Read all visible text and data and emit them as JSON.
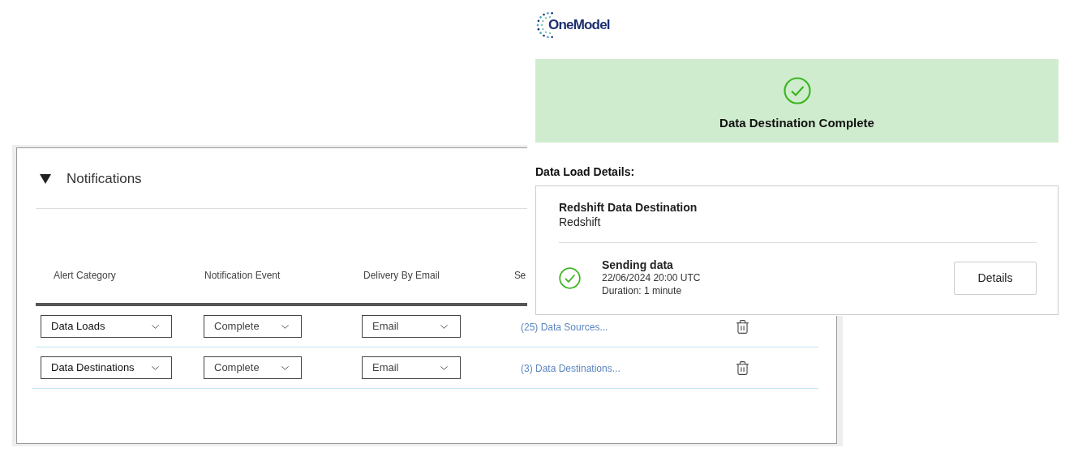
{
  "notifications_panel": {
    "title": "Notifications",
    "expanded": true,
    "columns": [
      "Alert Category",
      "Notification Event",
      "Delivery By Email",
      "Se"
    ],
    "rows": [
      {
        "alert_category": "Data Loads",
        "notification_event": "Complete",
        "delivery": "Email",
        "selection": "(25) Data Sources..."
      },
      {
        "alert_category": "Data Destinations",
        "notification_event": "Complete",
        "delivery": "Email",
        "selection": "(3) Data Destinations..."
      }
    ]
  },
  "email": {
    "logo": "OneModel",
    "banner": {
      "title": "Data Destination Complete"
    },
    "section_title": "Data Load Details:",
    "card": {
      "title": "Redshift Data Destination",
      "subtitle": "Redshift",
      "step": {
        "title": "Sending data",
        "time": "22/06/2024 20:00 UTC",
        "duration": "Duration: 1 minute",
        "button": "Details"
      }
    }
  }
}
